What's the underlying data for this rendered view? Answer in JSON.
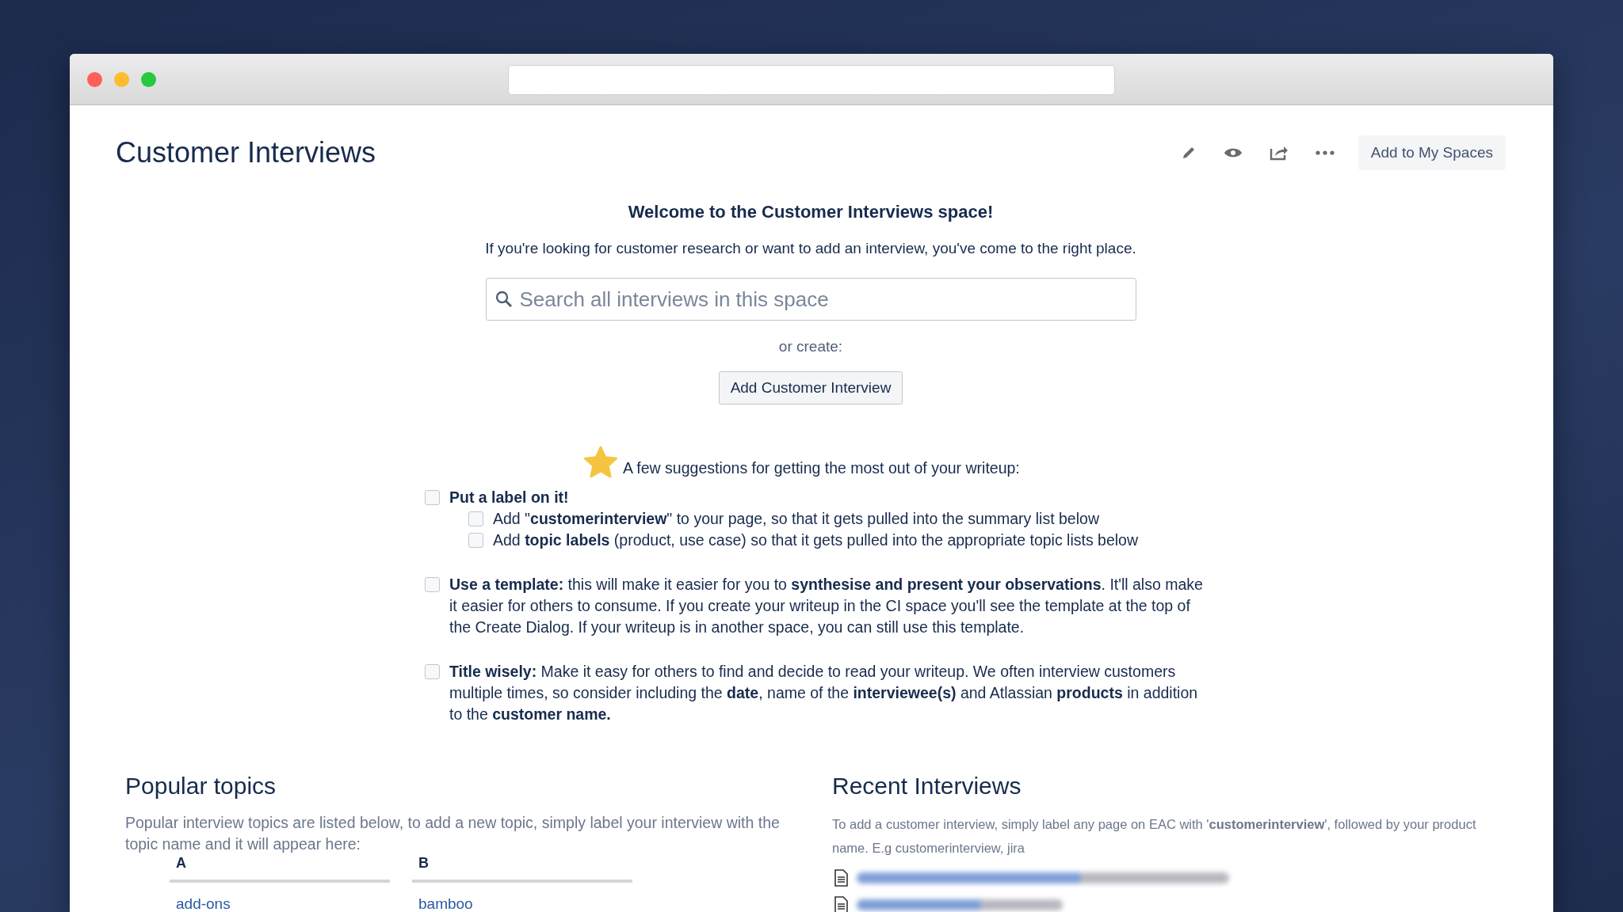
{
  "window": {
    "title": "Customer Interviews"
  },
  "toolbar": {
    "button": "Add to My Spaces"
  },
  "welcome": {
    "heading": "Welcome to the Customer Interviews space!",
    "text": "If you're looking for customer research or want to add an interview, you've come to the right place.",
    "search": {
      "placeholder": "Search all interviews in this space"
    },
    "or_create": "or create:",
    "create_button": "Add Customer Interview"
  },
  "suggestions": {
    "intro": "A few suggestions for getting the most out of your writeup:",
    "items": [
      {
        "text": "**Put a label on it!**",
        "checked": false,
        "children": [
          {
            "text": "Add \"**customerinterview**\" to your page, so that it gets pulled into the summary list below",
            "checked": false
          },
          {
            "text": "Add **topic labels** (product, use case) so that it gets pulled into the appropriate topic lists below",
            "checked": false
          }
        ]
      },
      {
        "text": "**Use a template:** this will make it easier for you to **synthesise and present your observations**. It'll also make it easier for others to consume. If you create your writeup in the CI space you'll see the template at the top of the Create Dialog. If your writeup is in another space, you can still use this template.",
        "checked": false
      },
      {
        "text": "**Title wisely:** Make it easy for others to find and decide to read your writeup. We often interview customers multiple times, so consider including the **date**, name of the **interviewee(s)** and Atlassian **products** in addition to the **customer name.**",
        "checked": false
      }
    ]
  },
  "popular_topics": {
    "heading": "Popular topics",
    "text": "Popular interview topics are listed below, to add a new topic, simply label your interview with the topic name and it will appear here:",
    "columns": [
      {
        "letter": "A",
        "links": [
          "add-ons"
        ]
      },
      {
        "letter": "B",
        "links": [
          "bamboo"
        ]
      }
    ]
  },
  "recent_interviews": {
    "heading": "Recent Interviews",
    "text": "To add a customer interview, simply label any page on EAC with '**customerinterview**', followed by your product name. E.g customerinterview, jira",
    "items": [
      {
        "kind": "blurred"
      },
      {
        "kind": "blurred"
      }
    ]
  }
}
